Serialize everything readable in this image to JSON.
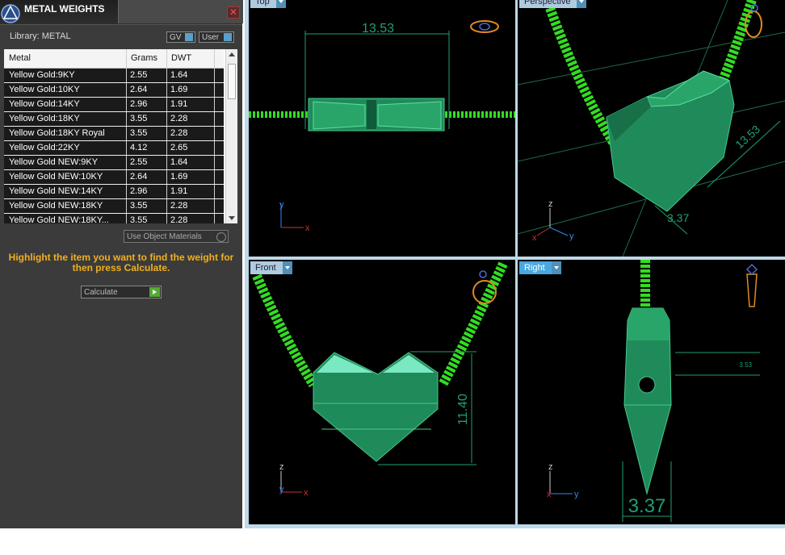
{
  "panel": {
    "title": "METAL WEIGHTS",
    "library_label": "Library: METAL",
    "gv_label": "GV",
    "user_label": "User",
    "close_glyph": "✕",
    "columns": [
      "Metal",
      "Grams",
      "DWT"
    ],
    "rows": [
      {
        "metal": "Yellow Gold:9KY",
        "grams": "2.55",
        "dwt": "1.64"
      },
      {
        "metal": "Yellow Gold:10KY",
        "grams": "2.64",
        "dwt": "1.69"
      },
      {
        "metal": "Yellow Gold:14KY",
        "grams": "2.96",
        "dwt": "1.91"
      },
      {
        "metal": "Yellow Gold:18KY",
        "grams": "3.55",
        "dwt": "2.28"
      },
      {
        "metal": "Yellow Gold:18KY Royal",
        "grams": "3.55",
        "dwt": "2.28"
      },
      {
        "metal": "Yellow Gold:22KY",
        "grams": "4.12",
        "dwt": "2.65"
      },
      {
        "metal": "Yellow Gold NEW:9KY",
        "grams": "2.55",
        "dwt": "1.64"
      },
      {
        "metal": "Yellow Gold NEW:10KY",
        "grams": "2.64",
        "dwt": "1.69"
      },
      {
        "metal": "Yellow Gold NEW:14KY",
        "grams": "2.96",
        "dwt": "1.91"
      },
      {
        "metal": "Yellow Gold NEW:18KY",
        "grams": "3.55",
        "dwt": "2.28"
      },
      {
        "metal": "Yellow Gold NEW:18KY...",
        "grams": "3.55",
        "dwt": "2.28"
      }
    ],
    "use_object_materials": "Use Object Materials",
    "hint": "Highlight the item you want to find the weight for then press Calculate.",
    "calculate_label": "Calculate"
  },
  "viewports": {
    "top": {
      "label": "Top",
      "dimension": "13.53"
    },
    "perspective": {
      "label": "Perspective",
      "dimension_a": "13.53",
      "dimension_b": "3.37"
    },
    "front": {
      "label": "Front",
      "dimension": "11.40"
    },
    "right": {
      "label": "Right",
      "dimension": "3.37",
      "dimension_small": "3.53"
    }
  },
  "axes": {
    "x": "x",
    "y": "y",
    "z": "z"
  },
  "colors": {
    "chain": "#33dd22",
    "model": "#1f8a5a",
    "model_light": "#48c88a",
    "dimension": "#1fa070",
    "axis_x": "#cc3333",
    "axis_y": "#3388ee",
    "axis_z": "#cccccc",
    "panel_bg": "#3b3b3b",
    "accent": "#f0b020"
  }
}
